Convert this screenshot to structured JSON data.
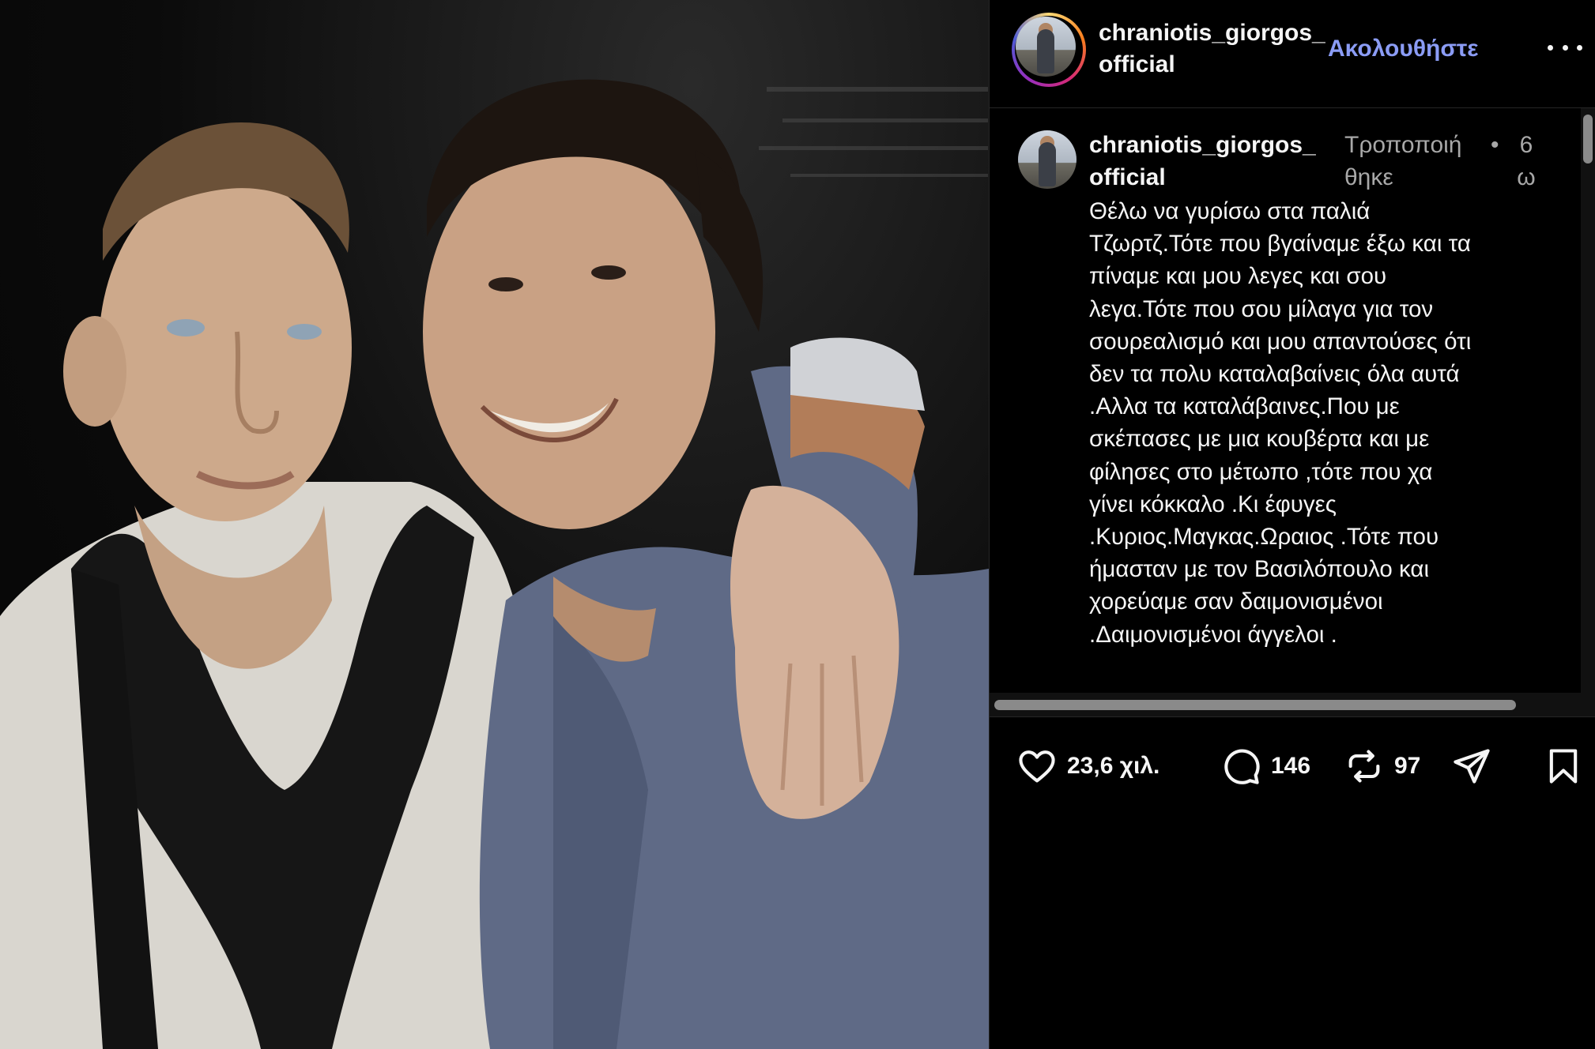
{
  "post": {
    "username_line1": "chraniotis_giorgos_",
    "username_line2": "official",
    "follow_label": "Ακολουθήστε",
    "more_icon": "more-horizontal-icon"
  },
  "caption": {
    "username_line1": "chraniotis_giorgos_",
    "username_line2": "official",
    "edited": "Τροποποιήθηκε",
    "dot": "•",
    "time": "6ω",
    "lines": [
      "Θέλω να γυρίσω στα παλιά",
      "Τζωρτζ.Τότε που βγαίναμε έξω και τα",
      "πίναμε και μου λεγες και σου",
      "λεγα.Τότε που σου μίλαγα για τον",
      "σουρεαλισμό και μου απαντούσες ότι",
      "δεν τα πολυ καταλαβαίνεις όλα αυτά",
      ".Αλλα τα καταλάβαινες.Που με",
      "σκέπασες με μια κουβέρτα και με",
      "φίλησες στο μέτωπο ,τότε που χα",
      "γίνει κόκκαλο .Κι έφυγες",
      ".Κυριος.Μαγκας.Ωραιος .Τότε που",
      "ήμασταν με τον Βασιλόπουλο και",
      "χορεύαμε σαν δαιμονισμένοι",
      ".Δαιμονισμένοι άγγελοι ."
    ]
  },
  "actions": {
    "likes": "23,6 χιλ.",
    "comments": "146",
    "reposts": "97",
    "like_icon": "heart-icon",
    "comment_icon": "comment-icon",
    "repost_icon": "repost-icon",
    "share_icon": "share-icon",
    "save_icon": "bookmark-icon"
  },
  "colors": {
    "background": "#000000",
    "follow": "#8b9cf5",
    "muted": "#a8a8a8",
    "text": "#f5f5f5"
  }
}
